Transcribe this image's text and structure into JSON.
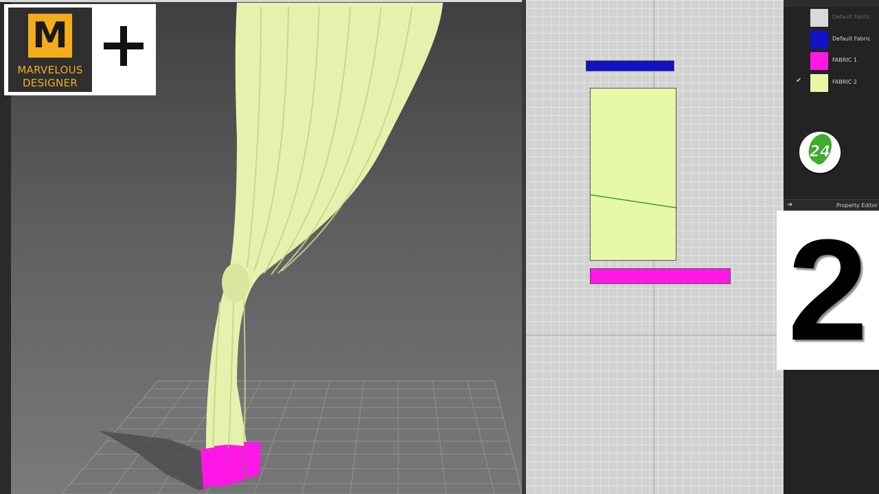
{
  "logo": {
    "letter": "M",
    "line1": "MARVELOUS",
    "line2": "DESIGNER",
    "plus": "+"
  },
  "fabric_list": [
    {
      "name": "Default Fabric",
      "color": "#d9d9d9",
      "selected": false,
      "dim": true
    },
    {
      "name": "Default Fabric",
      "color": "#1212c8",
      "selected": false,
      "dim": false
    },
    {
      "name": "FABRIC 1",
      "color": "#ff17e6",
      "selected": false,
      "dim": false
    },
    {
      "name": "FABRIC 2",
      "color": "#e7f7a8",
      "selected": true,
      "dim": false
    }
  ],
  "check_mark": "✔",
  "badge": {
    "text": "24"
  },
  "property_editor": {
    "label": "Property Editor",
    "arrow": "➜"
  },
  "episode_number": "2",
  "colors": {
    "fabric_yellow": "#e7f7a8",
    "fabric_magenta": "#ff17e6",
    "fabric_blue": "#1212c8",
    "brand_orange": "#f4ac1d",
    "badge_green": "#3fae2a"
  }
}
